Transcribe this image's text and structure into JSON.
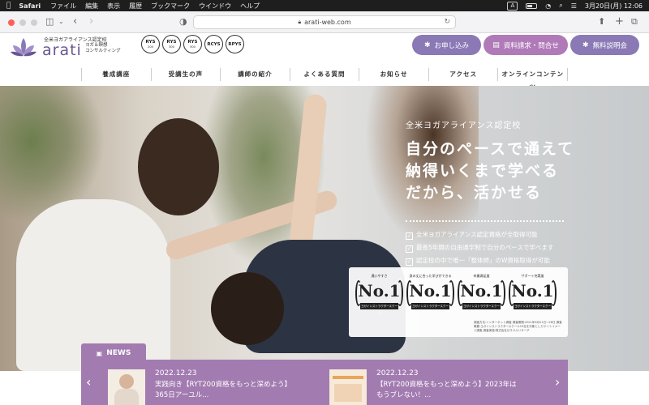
{
  "menubar": {
    "app": "Safari",
    "items": [
      "ファイル",
      "編集",
      "表示",
      "履歴",
      "ブックマーク",
      "ウインドウ",
      "ヘルプ"
    ],
    "input_mode": "A",
    "clock": "3月20日(月) 12:06"
  },
  "browser": {
    "url": "arati-web.com"
  },
  "logo": {
    "tagline": "全米ヨガアライアンス認定校",
    "name": "arati",
    "subtitle_line1": "ヨガ＆瞑想",
    "subtitle_line2": "コンサルティング"
  },
  "badges": [
    {
      "code": "RYS",
      "sub": "200"
    },
    {
      "code": "RYS",
      "sub": "300"
    },
    {
      "code": "RYS",
      "sub": "500"
    },
    {
      "code": "RCYS",
      "sub": ""
    },
    {
      "code": "RPYS",
      "sub": ""
    }
  ],
  "cta": {
    "apply": "お申し込み",
    "request": "資料請求・問合せ",
    "seminar": "無料説明会"
  },
  "nav": [
    "養成講座",
    "受講生の声",
    "講師の紹介",
    "よくある質問",
    "お知らせ",
    "アクセス",
    "オンラインコンテンツ"
  ],
  "hero": {
    "kicker": "全米ヨガアライアンス認定校",
    "title_line1": "自分のペースで通えて",
    "title_line2": "納得いくまで学べる",
    "title_line3": "だから、活かせる",
    "checks": [
      "全米ヨガアライアンス認定資格が全取得可能",
      "最長5年間の自由通学制で自分のペースで学べます",
      "認定校の中で唯一「整体師」のW資格取得が可能"
    ]
  },
  "awards": [
    {
      "caption": "通いやすさ",
      "rank": "No.1"
    },
    {
      "caption": "身の丈に合った学びができる",
      "rank": "No.1"
    },
    {
      "caption": "卒業満足度",
      "rank": "No.1"
    },
    {
      "caption": "サポート充実度",
      "rank": "No.1"
    }
  ],
  "award_ribbon": "ヨガインストラクタースクール",
  "award_note": "調査方法:インターネット調査 調査期間:2021年6月21日〜28日 調査概要:ヨガインストラクタースクール10社を対象としたサイトイメージ調査 調査実施:株式会社ゼネラルリサーチ",
  "colors": {
    "accent_purple": "#8a79b5",
    "accent_pink": "#b07ab8",
    "news_bg": "#a27bb0",
    "brand_text": "#6a5691"
  },
  "news": {
    "label": "NEWS",
    "items": [
      {
        "date": "2022.12.23",
        "title": "実践向き【RYT200資格をもっと深めよう】365日アーユル..."
      },
      {
        "date": "2022.12.23",
        "title": "【RYT200資格をもっと深めよう】2023年はもうブレない！..."
      }
    ]
  }
}
